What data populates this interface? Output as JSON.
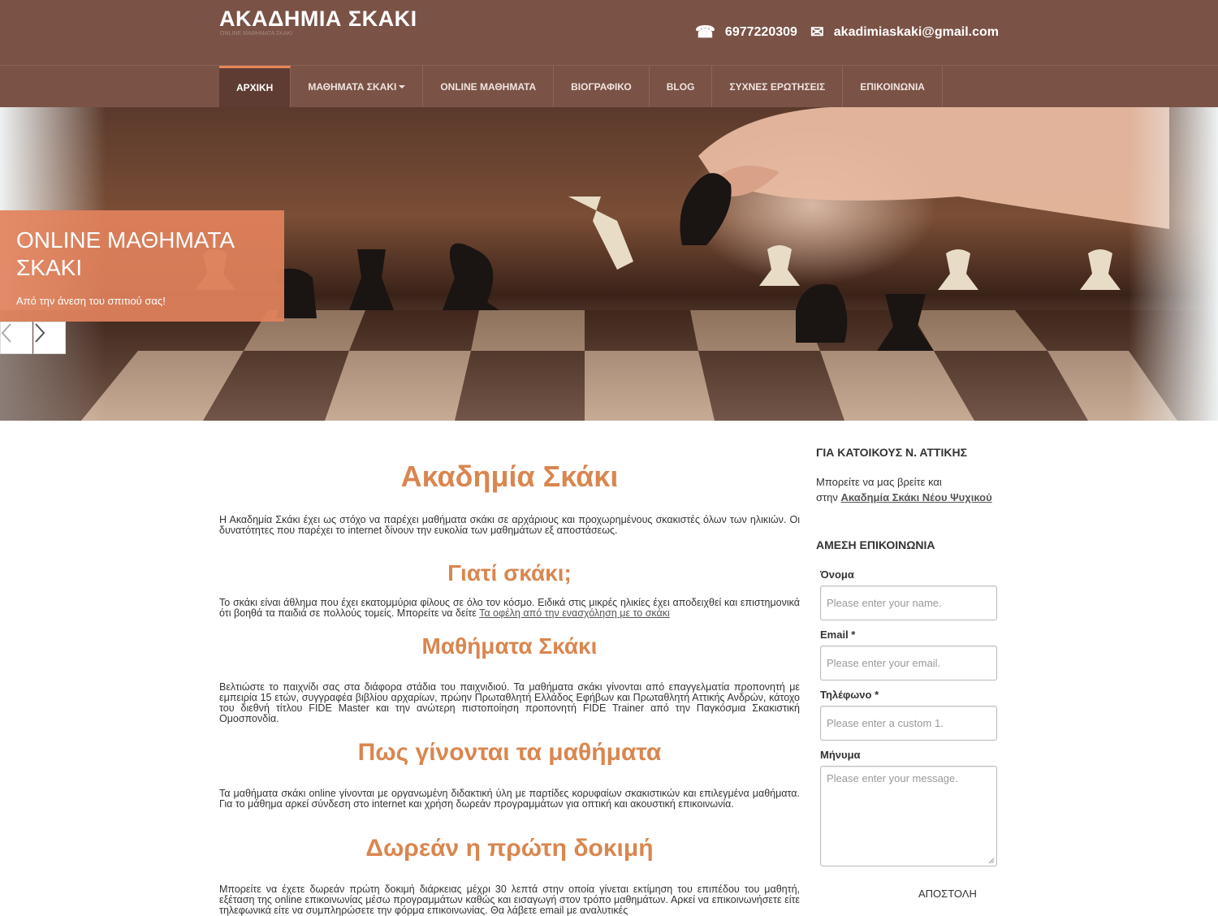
{
  "header": {
    "site_title": "ΑΚΑΔΗΜΙΑ ΣΚΑΚΙ",
    "tagline": "ONLINE ΜΑΘΗΜΑΤΑ ΣΚΑΚΙ",
    "phone": "6977220309",
    "email": "akadimiaskaki@gmail.com"
  },
  "nav": {
    "items": [
      {
        "label": "ΑΡΧΙΚΗ"
      },
      {
        "label": "ΜΑΘΗΜΑΤΑ ΣΚΑΚΙ"
      },
      {
        "label": "ONLINE ΜΑΘΗΜΑΤΑ"
      },
      {
        "label": "ΒΙΟΓΡΑΦΙΚΟ"
      },
      {
        "label": "BLOG"
      },
      {
        "label": "ΣΥΧΝΕΣ ΕΡΩΤΗΣΕΙΣ"
      },
      {
        "label": "ΕΠΙΚΟΙΝΩΝΙΑ"
      }
    ]
  },
  "hero": {
    "title": "ONLINE ΜΑΘΗΜΑΤΑ ΣΚΑΚΙ",
    "subtitle": "Από την άνεση του σπιτιού σας!"
  },
  "main": {
    "h1": "Ακαδημία Σκάκι",
    "p1": "Η Ακαδημία Σκάκι έχει ως στόχο να παρέχει μαθήματα σκάκι σε αρχάριους και προχωρημένους σκακιστές όλων των ηλικιών. Οι δυνατότητες που παρέχει το internet δίνουν την ευκολία των μαθημάτων εξ αποστάσεως.",
    "h2": "Γιατί σκάκι;",
    "p2": "Το σκάκι είναι άθλημα που έχει εκατομμύρια φίλους σε όλο τον κόσμο. Ειδικά στις μικρές ηλικίες έχει αποδειχθεί και επιστημονικά ότι βοηθά τα παιδιά σε πολλούς τομείς. Μπορείτε να δείτε ",
    "p2_link": "Τα οφέλη από την ενασχόληση με το σκάκι",
    "h3": "Μαθήματα Σκάκι",
    "p3": "Βελτιώστε το παιχνίδι σας στα διάφορα στάδια του παιχνιδιού. Τα μαθήματα σκάκι γίνονται από επαγγελματία προπονητή με εμπειρία 15 ετών, συγγραφέα βιβλίου αρχαρίων, πρώην Πρωταθλητή Ελλάδος Εφήβων και Πρωταθλητή Αττικής Ανδρών, κάτοχο του διεθνή τίτλου FIDE Master και την ανώτερη πιστοποίηση προπονητή FIDE Trainer από την Παγκόσμια Σκακιστική Ομοσπονδία.",
    "h4": "Πως γίνονται τα μαθήματα",
    "p4": "Τα μαθήματα σκάκι online γίνονται με οργανωμένη διδακτική ύλη με παρτίδες κορυφαίων σκακιστικών και επιλεγμένα μαθήματα. Για το μάθημα αρκεί σύνδεση στο internet και χρήση δωρεάν προγραμμάτων για οπτική και ακουστική επικοινωνία.",
    "h5": "Δωρεάν  η πρώτη δοκιμή",
    "p5": "Μπορείτε να έχετε δωρεάν πρώτη δοκιμή διάρκειας μέχρι 30 λεπτά στην οποία γίνεται εκτίμηση του επιπέδου του μαθητή, εξέταση της online επικοινωνίας μέσω προγραμμάτων καθώς και εισαγωγή στον τρόπο μαθημάτων. Αρκεί να επικοινωνήσετε είτε τηλεφωνικά είτε να συμπληρώσετε την φόρμα επικοινωνίας. Θα λάβετε email με αναλυτικές"
  },
  "sidebar": {
    "heading1": "ΓΙΑ ΚΑΤΟΙΚΟΥΣ Ν. ΑΤΤΙΚΗΣ",
    "text1": "Μπορείτε να μας βρείτε και",
    "text2": "στην ",
    "link1": "Ακαδημία Σκάκι Νέου Ψυχικού",
    "heading2": "ΑΜΕΣΗ ΕΠΙΚΟΙΝΩΝΙΑ",
    "form": {
      "name_label": "Όνομα",
      "name_placeholder": "Please enter your name.",
      "email_label": "Email *",
      "email_placeholder": "Please enter your email.",
      "phone_label": "Τηλέφωνο *",
      "phone_placeholder": "Please enter a custom 1.",
      "message_label": "Μήνυμα",
      "message_placeholder": "Please enter your message.",
      "submit": "ΑΠΟΣΤΟΛΗ"
    }
  },
  "colors": {
    "header_bg": "#7a5246",
    "accent": "#d9864f",
    "caption_bg": "#e2825c"
  },
  "icons": {
    "phone": "phone-icon",
    "mail": "mail-icon",
    "prev": "chevron-left-icon",
    "next": "chevron-right-icon"
  }
}
